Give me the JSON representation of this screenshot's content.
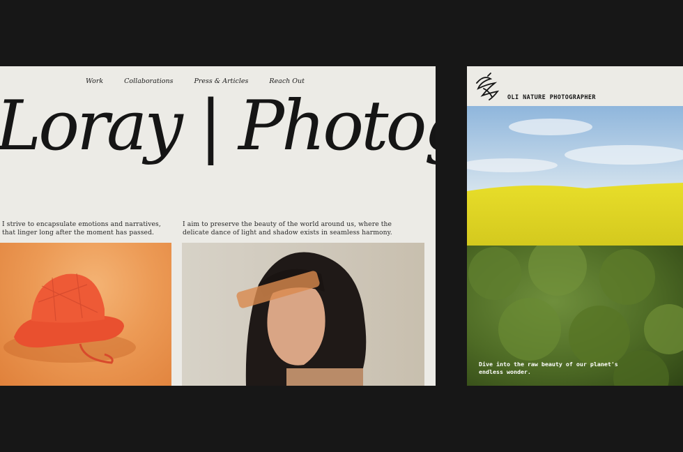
{
  "left_site": {
    "nav": [
      {
        "label": "Work"
      },
      {
        "label": "Collaborations"
      },
      {
        "label": "Press & Articles"
      },
      {
        "label": "Reach Out"
      }
    ],
    "hero_title": "Loray | Photogra",
    "intro_left": "I strive to encapsulate emotions and narratives, that linger long after the moment has passed.",
    "intro_right": "I aim to preserve the beauty of the world around us, where the delicate dance of light and shadow exists in seamless harmony."
  },
  "right_site": {
    "brand": "OLI NATURE PHOTOGRAPHER",
    "tagline": "Dive into the raw beauty of our planet's endless wonder."
  },
  "colors": {
    "background": "#171717",
    "paper": "#ecebe6",
    "ink": "#151515"
  }
}
